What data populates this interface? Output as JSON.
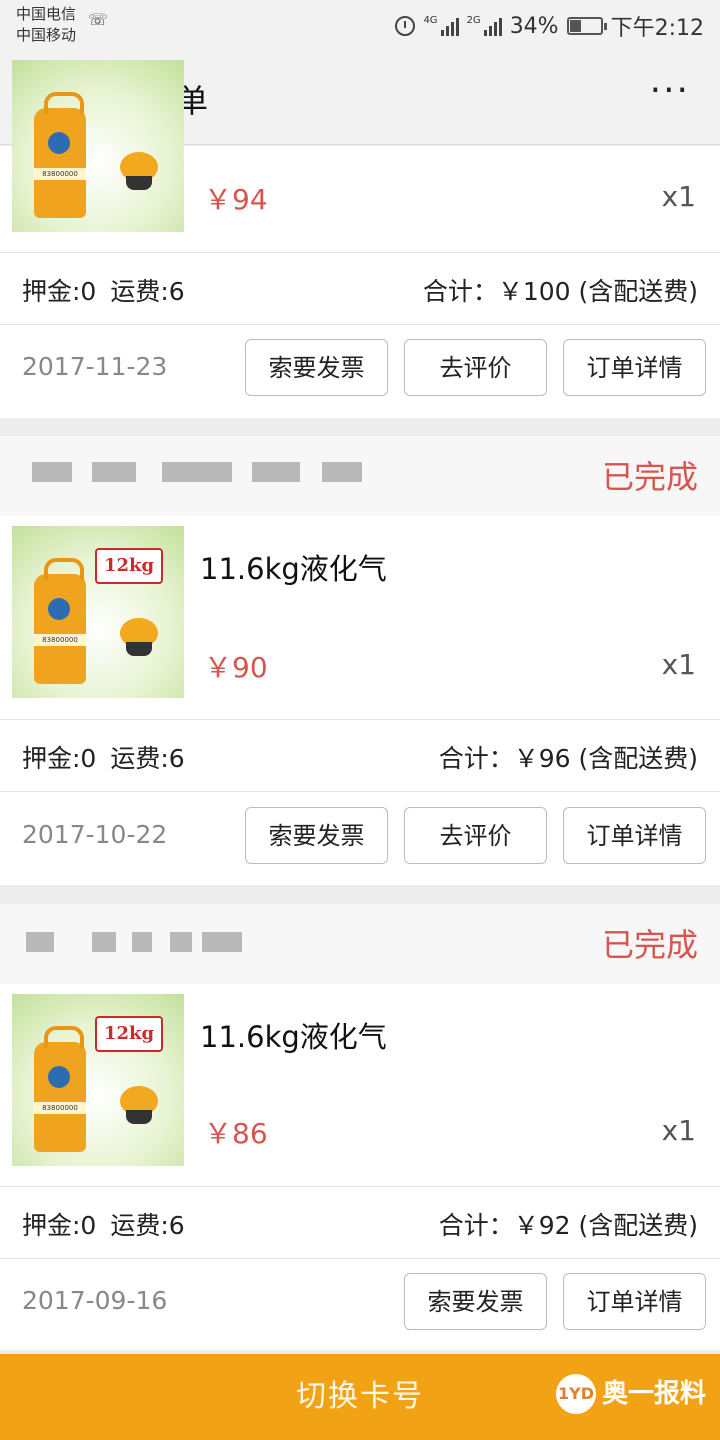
{
  "status_bar": {
    "carrier_1": "中国电信",
    "carrier_2": "中国移动",
    "battery": "34%",
    "time": "下午2:12",
    "signal_1_label": "4G",
    "signal_2_label": "2G",
    "icons": [
      "missed-call-icon",
      "alarm-icon",
      "signal-icon",
      "battery-icon"
    ]
  },
  "header": {
    "close_icon": "close-icon",
    "title": "我的订单",
    "more_icon": "more-icon"
  },
  "orders": [
    {
      "status": "",
      "product_name": "",
      "kg_tag": "",
      "price": "￥94",
      "quantity": "x1",
      "deposit": "押金:0",
      "shipping": "运费:6",
      "total": "合计：￥100 (含配送费)",
      "date": "2017-11-23",
      "buttons": [
        "索要发票",
        "去评价",
        "订单详情"
      ]
    },
    {
      "status": "已完成",
      "product_name": "11.6kg液化气",
      "kg_tag": "12kg",
      "price": "￥90",
      "quantity": "x1",
      "deposit": "押金:0",
      "shipping": "运费:6",
      "total": "合计：￥96 (含配送费)",
      "date": "2017-10-22",
      "buttons": [
        "索要发票",
        "去评价",
        "订单详情"
      ]
    },
    {
      "status": "已完成",
      "product_name": "11.6kg液化气",
      "kg_tag": "12kg",
      "price": "￥86",
      "quantity": "x1",
      "deposit": "押金:0",
      "shipping": "运费:6",
      "total": "合计：￥92 (含配送费)",
      "date": "2017-09-16",
      "buttons": [
        "索要发票",
        "订单详情"
      ]
    }
  ],
  "bottom": {
    "switch_label": "切换卡号",
    "watermark_badge": "1YD",
    "watermark_text": "奥一报料"
  },
  "colors": {
    "accent_orange": "#f2a315",
    "status_red": "#d6554f"
  }
}
